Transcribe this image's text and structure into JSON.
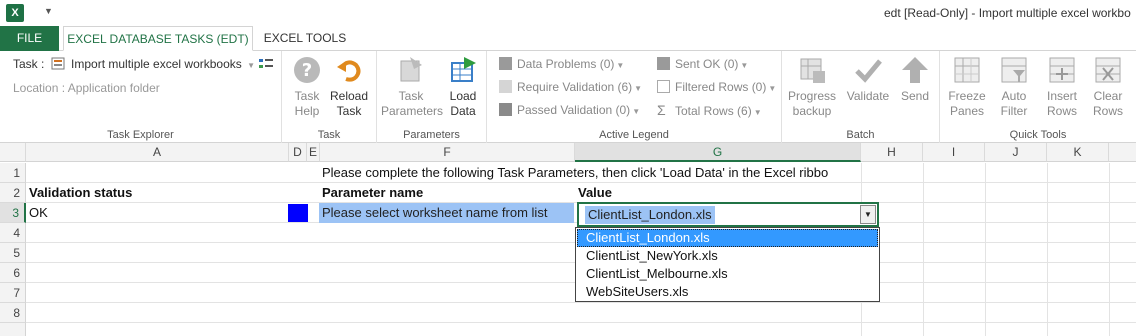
{
  "window": {
    "app_icon": "excel-logo",
    "app_icon_letter": "X",
    "title": "edt  [Read-Only] - Import multiple excel workbo"
  },
  "tabs": [
    {
      "label": "FILE"
    },
    {
      "label": "EXCEL DATABASE TASKS (EDT)"
    },
    {
      "label": "EXCEL TOOLS"
    }
  ],
  "ribbon": {
    "task_explorer": {
      "task_label": "Task :",
      "task_value": "Import multiple excel workbooks",
      "location": "Location : Application folder",
      "group_label": "Task Explorer"
    },
    "task": {
      "help_label": "Task Help",
      "reload_label": "Reload Task",
      "group_label": "Task"
    },
    "parameters": {
      "task_params_label": "Task Parameters",
      "load_data_label": "Load Data",
      "group_label": "Parameters"
    },
    "active_legend": {
      "data_problems": "Data Problems (0)",
      "require_validation": "Require Validation (6)",
      "passed_validation": "Passed Validation (0)",
      "sent_ok": "Sent OK (0)",
      "filtered_rows": "Filtered Rows (0)",
      "total_rows": "Total Rows (6)",
      "group_label": "Active Legend"
    },
    "batch": {
      "progress_backup": "Progress backup",
      "validate": "Validate",
      "send": "Send",
      "group_label": "Batch"
    },
    "quick_tools": {
      "freeze_panes": "Freeze Panes",
      "auto_filter": "Auto Filter",
      "insert_rows": "Insert Rows",
      "clear_rows": "Clear Rows",
      "group_label": "Quick Tools"
    }
  },
  "grid": {
    "columns": [
      "A",
      "D",
      "E",
      "F",
      "G",
      "H",
      "I",
      "J",
      "K"
    ],
    "rows": [
      "1",
      "2",
      "3",
      "4",
      "5",
      "6",
      "7",
      "8"
    ],
    "cells": {
      "f1": "Please complete the following Task Parameters, then click 'Load Data' in the Excel ribbo",
      "a2": "Validation status",
      "f2": "Parameter name",
      "g2": "Value",
      "a3": "OK",
      "f3": "Please select worksheet name from list",
      "g3": "ClientList_London.xls"
    },
    "dropdown_options": [
      "ClientList_London.xls",
      "ClientList_NewYork.xls",
      "ClientList_Melbourne.xls",
      "WebSiteUsers.xls"
    ],
    "selected_option": "ClientList_London.xls"
  }
}
